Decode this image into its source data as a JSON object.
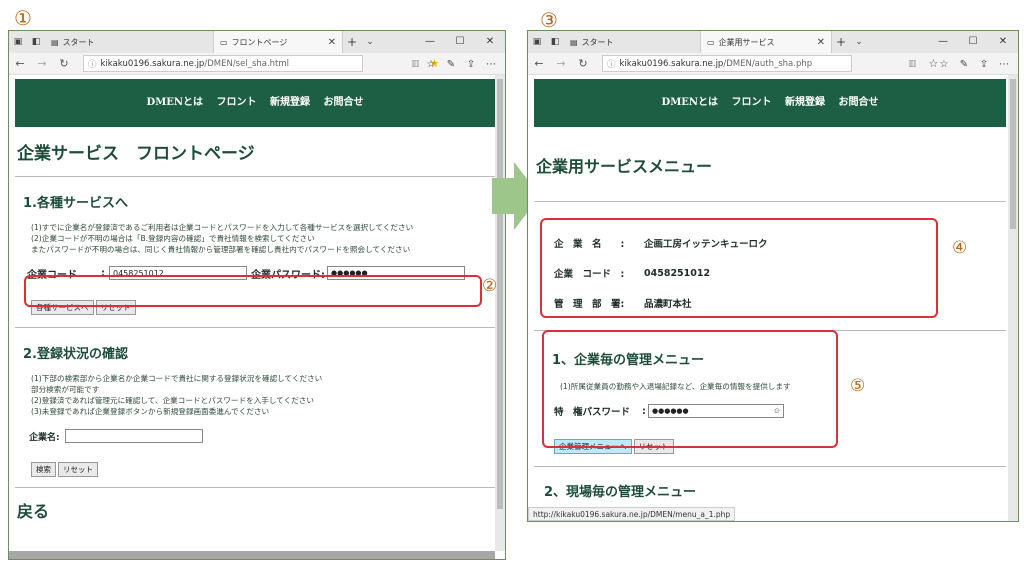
{
  "markers": {
    "step1": "①",
    "step2": "②",
    "step3": "③",
    "step4": "④",
    "step5": "⑤"
  },
  "left_window": {
    "tab1_title": "スタート",
    "tab2_title": "フロントページ",
    "url_prefix": "kikaku0196.sakura.ne.jp",
    "url_path": "/DMEN/sel_sha.html",
    "nav_links": [
      "DMENとは",
      "フロント",
      "新規登録",
      "お問合せ"
    ],
    "page_title": "企業サービス　フロントページ",
    "section1": {
      "heading": "1.各種サービスへ",
      "note1": "(1)すでに企業名が登録済であるご利用者は企業コードとパスワードを入力して各種サービスを選択してください",
      "note2": "(2)企業コードが不明の場合は「B.登録内容の確認」で貴社情報を検索してください",
      "note3": "またパスワードが不明の場合は、同じく貴社情報から管理部署を確認し貴社内でパスワードを照会してください",
      "code_label": "企業コード",
      "code_sep": ":",
      "code_value": "0458251012",
      "password_label": "企業パスワード:",
      "password_value": "●●●●●●",
      "submit_label": "各種サービスへ",
      "reset_label": "リセット"
    },
    "section2": {
      "heading": "2.登録状況の確認",
      "note1": "(1)下部の検索部から企業名か企業コードで貴社に関する登録状況を確認してください",
      "note2": "部分検索が可能です",
      "note3": "(2)登録済であれば管理元に確認して、企業コードとパスワードを入手してください",
      "note4": "(3)未登録であれば企業登録ボタンから新規登録画面委進んでください",
      "name_label": "企業名:",
      "search_label": "検索",
      "reset_label": "リセット"
    },
    "back_label": "戻る"
  },
  "right_window": {
    "tab1_title": "スタート",
    "tab2_title": "企業用サービス",
    "url_prefix": "kikaku0196.sakura.ne.jp",
    "url_path": "/DMEN/auth_sha.php",
    "nav_links": [
      "DMENとは",
      "フロント",
      "新規登録",
      "お問合せ"
    ],
    "page_title": "企業用サービスメニュー",
    "company": {
      "name_label": "企　業　名　　:",
      "name_value": "企画工房イッテンキューロク",
      "code_label": "企業　コード　:",
      "code_value": "0458251012",
      "dept_label": "管　理　部　署:",
      "dept_value": "品濃町本社"
    },
    "section1": {
      "heading": "1、企業毎の管理メニュー",
      "note": "(1)所属従業員の勤務や入退場記録など、企業毎の情報を提供します",
      "password_label": "特　権パスワード",
      "password_sep": ":",
      "password_value": "●●●●●●",
      "submit_label": "企業管理メニューへ",
      "reset_label": "リセット"
    },
    "section2": {
      "heading": "2、現場毎の管理メニュー"
    },
    "status_url": "http://kikaku0196.sakura.ne.jp/DMEN/menu_a_1.php"
  },
  "colors": {
    "header_green": "#1d5f45",
    "annotation_red": "#d9303a",
    "arrow_green": "#9cc68a",
    "marker_brown": "#b5651d"
  }
}
